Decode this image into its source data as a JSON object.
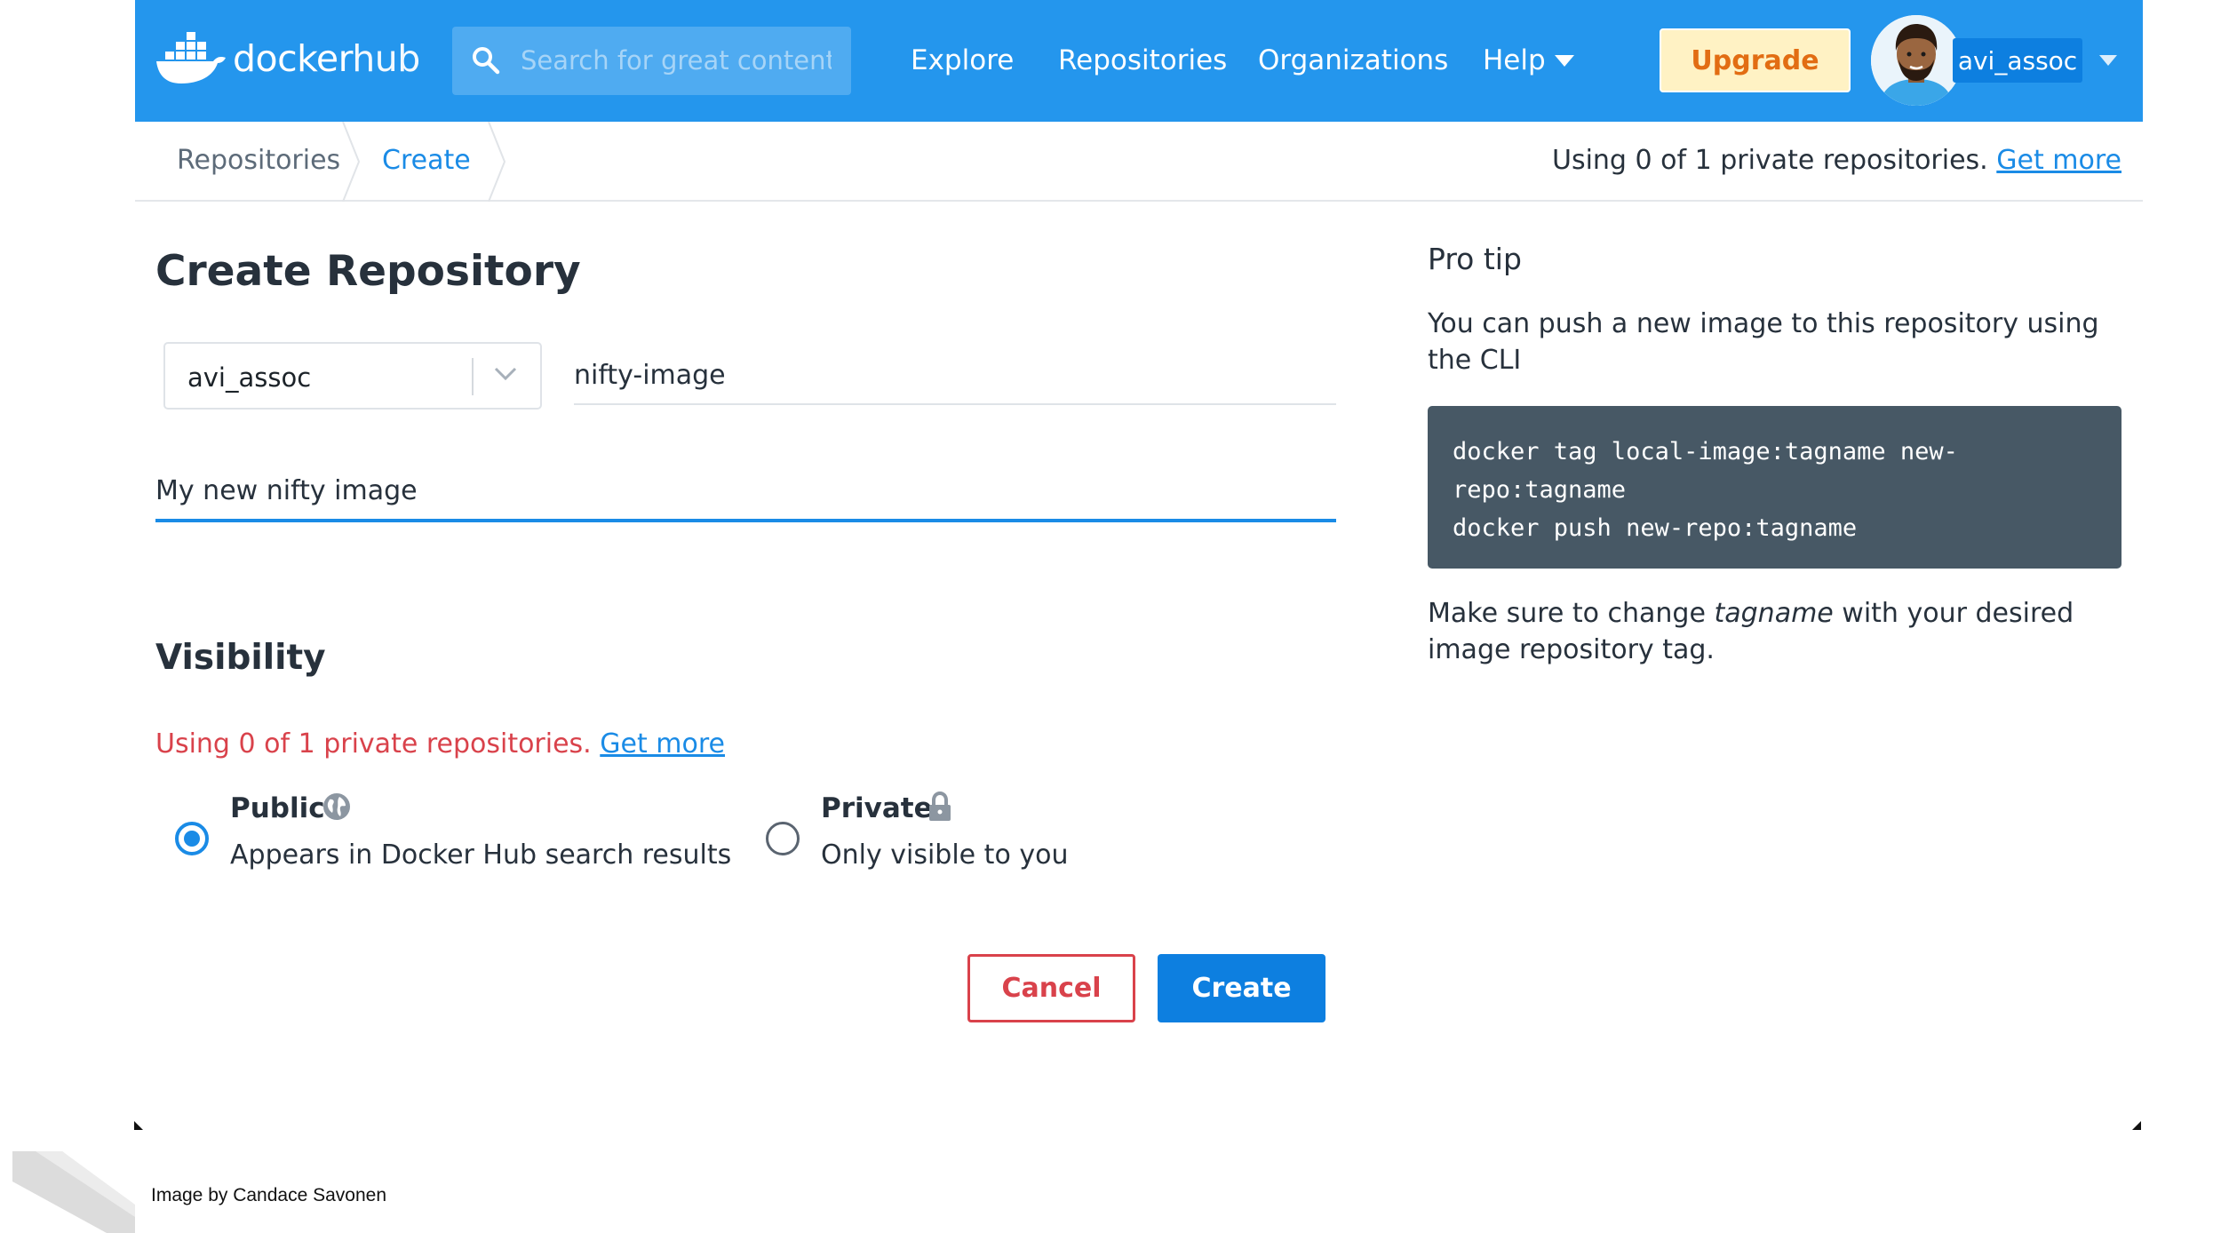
{
  "header": {
    "logo_text": "docker",
    "logo_text_hub": "hub",
    "search_placeholder": "Search for great content",
    "nav": [
      "Explore",
      "Repositories",
      "Organizations",
      "Help"
    ],
    "upgrade_label": "Upgrade",
    "username": "avi_assoc",
    "brand_color": "#2496ed"
  },
  "breadcrumb": {
    "items": [
      "Repositories",
      "Create"
    ],
    "usage_text": "Using 0 of 1 private repositories.",
    "get_more": "Get more"
  },
  "form": {
    "title": "Create Repository",
    "namespace": "avi_assoc",
    "repo_name": "nifty-image",
    "description": "My new nifty image",
    "visibility_title": "Visibility",
    "visibility_warning": "Using 0 of 1 private repositories.",
    "visibility_get_more": "Get more",
    "options": [
      {
        "title": "Public",
        "desc": "Appears in Docker Hub search results",
        "icon": "globe-icon",
        "selected": true
      },
      {
        "title": "Private",
        "desc": "Only visible to you",
        "icon": "lock-icon",
        "selected": false
      }
    ],
    "cancel_label": "Cancel",
    "create_label": "Create"
  },
  "protip": {
    "title": "Pro tip",
    "text": "You can push a new image to this repository using the CLI",
    "code": [
      "docker tag local-image:tagname new-",
      "repo:tagname",
      "docker push new-repo:tagname"
    ],
    "note_before": "Make sure to change ",
    "note_em": "tagname",
    "note_after": " with your desired image repository tag."
  },
  "credit": "Image by Candace Savonen"
}
